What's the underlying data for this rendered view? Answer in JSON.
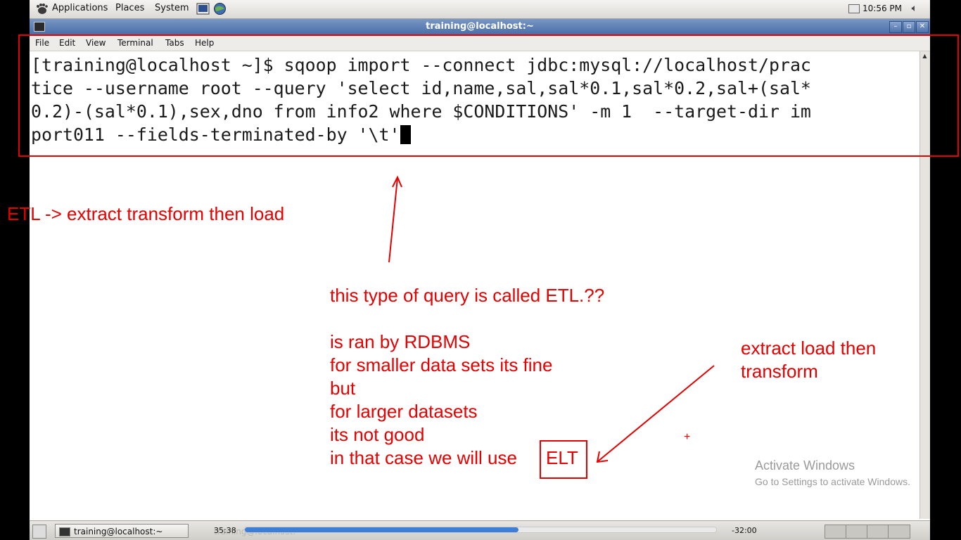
{
  "top_panel": {
    "menus": [
      "Applications",
      "Places",
      "System"
    ],
    "clock": "10:56 PM"
  },
  "window": {
    "title": "training@localhost:~",
    "menubar": [
      "File",
      "Edit",
      "View",
      "Terminal",
      "Tabs",
      "Help"
    ]
  },
  "terminal": {
    "lines": [
      "[training@localhost ~]$ sqoop import --connect jdbc:mysql://localhost/prac",
      "tice --username root --query 'select id,name,sal,sal*0.1,sal*0.2,sal+(sal*",
      "0.2)-(sal*0.1),sex,dno from info2 where $CONDITIONS' -m 1  --target-dir im",
      "port011 --fields-terminated-by '\\t'"
    ]
  },
  "annotations": {
    "etl_definition": "ETL -> extract transform then load",
    "question": "this type of query is called ETL.??",
    "notes": [
      "is ran by RDBMS",
      "for smaller data sets its fine",
      "but",
      "for larger datasets",
      "its not good",
      "in that case we will use"
    ],
    "elt": "ELT",
    "elt_definition": [
      "extract load then",
      "transform"
    ],
    "plus": "+"
  },
  "watermark": {
    "title": "Activate Windows",
    "subtitle": "Go to Settings to activate Windows."
  },
  "bottom_panel": {
    "task_label": "training@localhost:~",
    "ghost_label": "training@localhost:~",
    "time_elapsed": "35:38",
    "time_remaining": "-32:00",
    "progress_fraction": 0.58
  },
  "colors": {
    "annotation": "#e60000",
    "title_bar": "#5a7fb8",
    "progress": "#3d7ed8"
  }
}
